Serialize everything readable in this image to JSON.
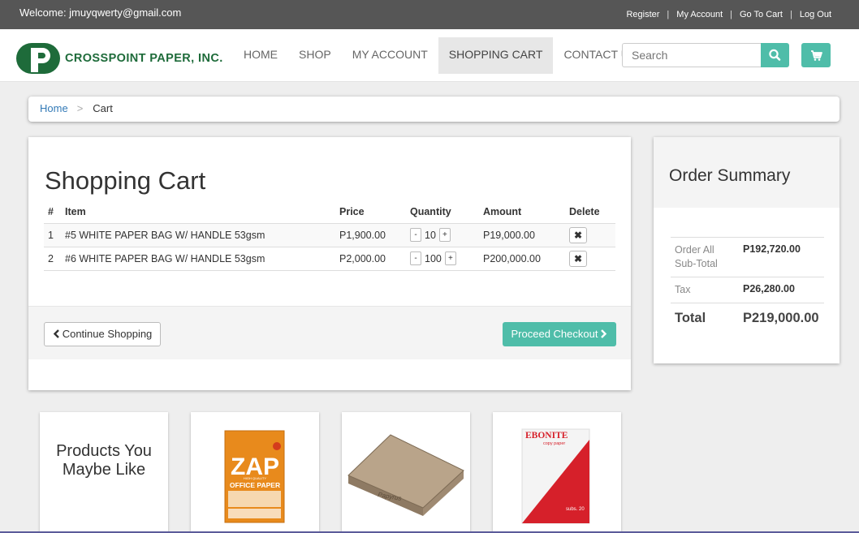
{
  "topbar": {
    "welcome": "Welcome: jmuyqwerty@gmail.com",
    "links": [
      "Register",
      "My Account",
      "Go To Cart",
      "Log Out"
    ],
    "separator": "|"
  },
  "brand": {
    "name": "CROSSPOINT PAPER, INC.",
    "color": "#1e6b3a"
  },
  "nav": {
    "items": [
      "HOME",
      "SHOP",
      "MY ACCOUNT",
      "SHOPPING CART",
      "CONTACT US"
    ],
    "active": "SHOPPING CART",
    "search_placeholder": "Search",
    "accent": "#4fbda9"
  },
  "breadcrumb": {
    "home": "Home",
    "separator": ">",
    "current": "Cart"
  },
  "cart": {
    "title": "Shopping Cart",
    "headers": [
      "#",
      "Item",
      "Price",
      "Quantity",
      "Amount",
      "Delete"
    ],
    "rows": [
      {
        "num": "1",
        "item": "#5 WHITE PAPER BAG W/ HANDLE 53gsm",
        "price": "P1,900.00",
        "qty": "10",
        "amount": "P19,000.00"
      },
      {
        "num": "2",
        "item": "#6 WHITE PAPER BAG W/ HANDLE 53gsm",
        "price": "P2,000.00",
        "qty": "100",
        "amount": "P200,000.00"
      }
    ],
    "minus": "-",
    "plus": "+",
    "continue_label": "Continue Shopping",
    "checkout_label": "Proceed Checkout"
  },
  "summary": {
    "title": "Order Summary",
    "subtotal_label": "Order All Sub-Total",
    "subtotal": "P192,720.00",
    "tax_label": "Tax",
    "tax": "P26,280.00",
    "total_label": "Total",
    "total": "P219,000.00"
  },
  "products": {
    "heading": "Products You Maybe Like",
    "zap": {
      "brand": "ZAP",
      "subtitle": "OFFICE PAPER",
      "tagline": "HIGH QUALITY"
    },
    "box": {
      "text": "Papyrus"
    },
    "ebonite": {
      "brand": "EBONITE",
      "sub": "copy paper",
      "detail": "subs. 20"
    }
  }
}
